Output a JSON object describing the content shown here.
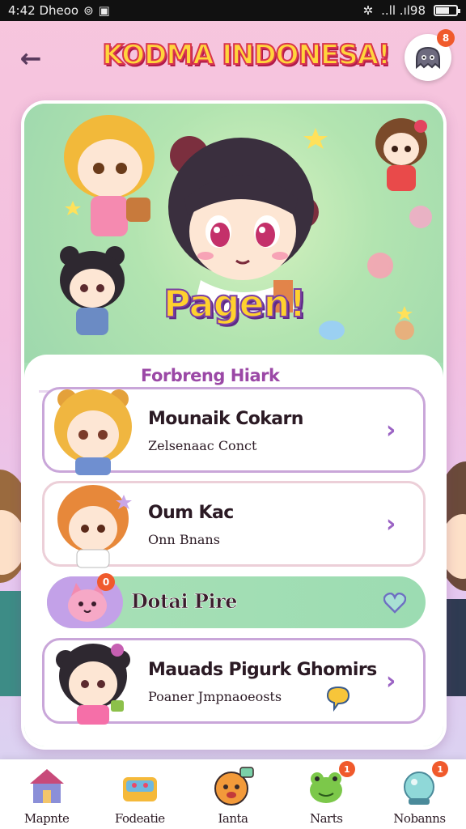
{
  "status_bar": {
    "time_text": "4:42 Dheoo",
    "signal_text": "..ll .ıl98"
  },
  "header": {
    "title": "KODMA INDONESA!",
    "mascot_badge": "8"
  },
  "hero": {
    "title": "Pagen!"
  },
  "list": {
    "section_title": "Forbreng Hiark",
    "items": [
      {
        "title": "Mounaik Cokarn",
        "subtitle": "Zelsenaac Conct"
      },
      {
        "title": "Oum Kac",
        "subtitle": "Onn Bnans"
      },
      {
        "title": "Mauads Pigurk Ghomirs",
        "subtitle": "Poaner Jmpnaoeosts"
      }
    ],
    "highlight": {
      "label": "Dotai Pire",
      "badge": "0"
    }
  },
  "bottom_nav": [
    {
      "label": "Mapnte",
      "icon": "house-icon",
      "badge": ""
    },
    {
      "label": "Fodeatie",
      "icon": "toy-box-icon",
      "badge": ""
    },
    {
      "label": "Ianta",
      "icon": "emoji-chat-icon",
      "badge": ""
    },
    {
      "label": "Narts",
      "icon": "frog-mascot-icon",
      "badge": "1"
    },
    {
      "label": "Nobanns",
      "icon": "crystal-ball-icon",
      "badge": "1"
    }
  ],
  "colors": {
    "accent_purple": "#9b48a6",
    "title_yellow": "#ffd63c",
    "title_red": "#d9354c",
    "mint": "#a8e0b6",
    "badge_orange": "#f05a2c"
  }
}
